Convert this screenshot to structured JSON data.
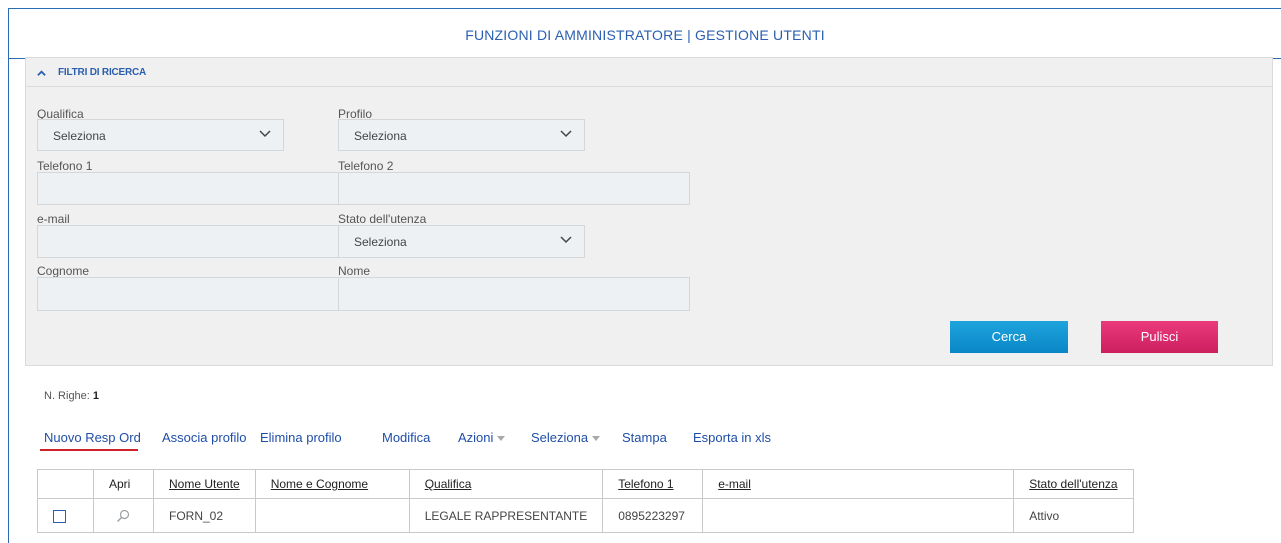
{
  "header": {
    "title": "FUNZIONI DI AMMINISTRATORE | GESTIONE UTENTI"
  },
  "filters": {
    "section_label": "FILTRI DI RICERCA",
    "qualifica": {
      "label": "Qualifica",
      "value": "Seleziona"
    },
    "profilo": {
      "label": "Profilo",
      "value": "Seleziona"
    },
    "telefono1": {
      "label": "Telefono 1",
      "value": ""
    },
    "telefono2": {
      "label": "Telefono 2",
      "value": ""
    },
    "email": {
      "label": "e-mail",
      "value": ""
    },
    "stato": {
      "label": "Stato dell'utenza",
      "value": "Seleziona"
    },
    "cognome": {
      "label": "Cognome",
      "value": ""
    },
    "nome": {
      "label": "Nome",
      "value": ""
    },
    "search_label": "Cerca",
    "clear_label": "Pulisci"
  },
  "results": {
    "count_label": "N. Righe:",
    "count_value": "1"
  },
  "toolbar": {
    "nuovo": "Nuovo Resp Ord",
    "associa": "Associa profilo",
    "elimina": "Elimina profilo",
    "modifica": "Modifica",
    "azioni": "Azioni",
    "seleziona": "Seleziona",
    "stampa": "Stampa",
    "esporta": "Esporta in xls"
  },
  "table": {
    "headers": [
      "",
      "Apri",
      "Nome Utente",
      "Nome e Cognome",
      "Qualifica",
      "Telefono 1",
      "e-mail",
      "Stato dell'utenza"
    ],
    "rows": [
      {
        "nome_utente": "FORN_02",
        "nome_cognome": "",
        "qualifica": "LEGALE RAPPRESENTANTE",
        "telefono1": "0895223297",
        "email": "",
        "stato": "Attivo"
      }
    ]
  },
  "colors": {
    "accent_blue": "#2a5fb0",
    "cerca": "#0a86c6",
    "pulisci": "#cc1f5e",
    "underline_red": "#d0222a"
  }
}
